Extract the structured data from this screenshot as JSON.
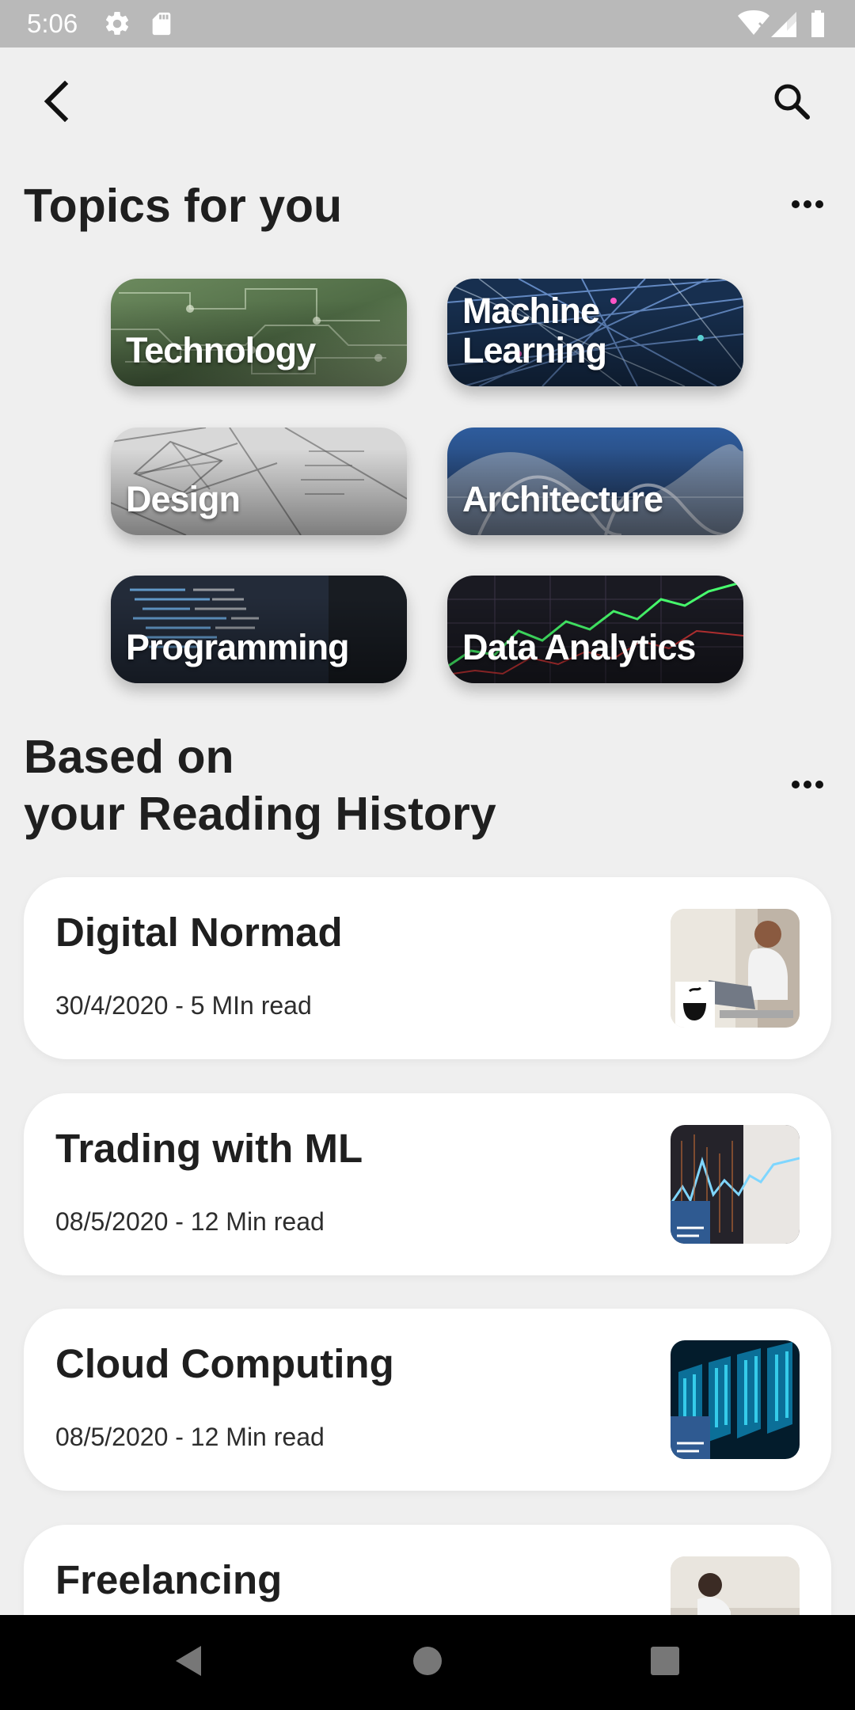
{
  "status_bar": {
    "time": "5:06"
  },
  "app_bar": {
    "back_icon": "back-arrow-icon",
    "search_icon": "search-icon"
  },
  "topics": {
    "title": "Topics for you",
    "more_icon": "more-horizontal-icon",
    "items": [
      {
        "label": "Technology"
      },
      {
        "label": "Machine Learning"
      },
      {
        "label": "Design"
      },
      {
        "label": "Architecture"
      },
      {
        "label": "Programming"
      },
      {
        "label": "Data Analytics"
      }
    ]
  },
  "history": {
    "title_line1": "Based on",
    "title_line2": "your Reading History",
    "more_icon": "more-horizontal-icon",
    "articles": [
      {
        "title": "Digital Normad",
        "meta": "30/4/2020 - 5 MIn read"
      },
      {
        "title": "Trading with ML",
        "meta": "08/5/2020 - 12 Min read"
      },
      {
        "title": "Cloud Computing",
        "meta": "08/5/2020 - 12 Min read"
      },
      {
        "title": "Freelancing",
        "meta": ""
      }
    ]
  },
  "navigation": {
    "back_icon": "nav-back-icon",
    "home_icon": "nav-home-icon",
    "recents_icon": "nav-recents-icon"
  },
  "colors": {
    "background": "#efefef",
    "status_bar": "#b9b9b9",
    "card": "#ffffff",
    "text": "#1f1f1f",
    "nav_bar": "#000000"
  }
}
